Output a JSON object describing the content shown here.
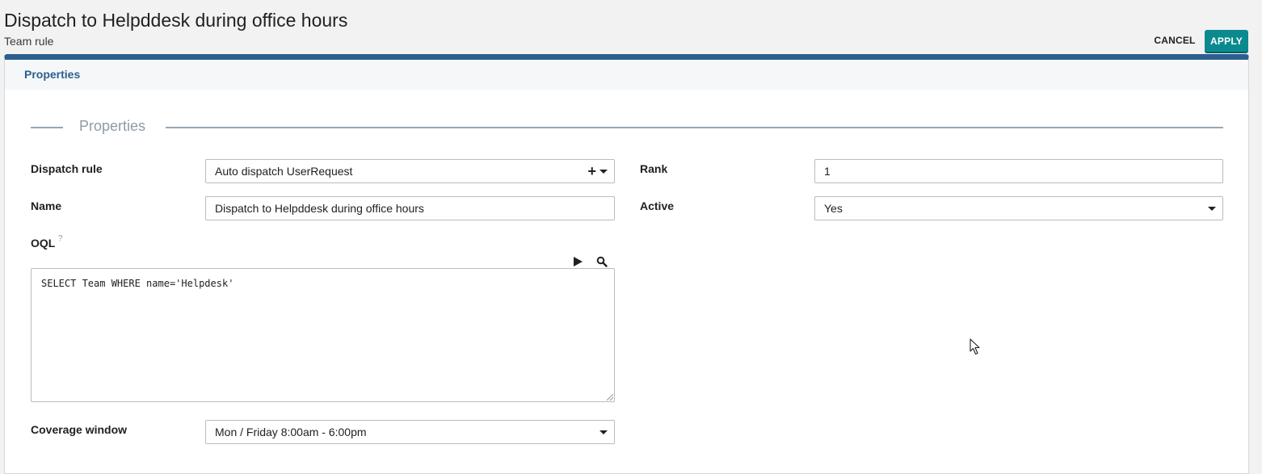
{
  "header": {
    "title": "Dispatch to Helpddesk during office hours",
    "subtitle": "Team rule",
    "cancel_label": "CANCEL",
    "apply_label": "APPLY"
  },
  "tabs": [
    {
      "label": "Properties",
      "active": true
    }
  ],
  "fieldset": {
    "legend": "Properties"
  },
  "fields": {
    "dispatch_rule": {
      "label": "Dispatch rule",
      "value": "Auto dispatch UserRequest"
    },
    "name": {
      "label": "Name",
      "value": "Dispatch to Helpddesk during office hours"
    },
    "oql": {
      "label": "OQL",
      "help": "?",
      "value": "SELECT Team WHERE name='Helpdesk'"
    },
    "coverage_window": {
      "label": "Coverage window",
      "value": "Mon / Friday 8:00am - 6:00pm"
    },
    "rank": {
      "label": "Rank",
      "value": "1"
    },
    "active": {
      "label": "Active",
      "value": "Yes"
    }
  },
  "icons": {
    "add": "plus-icon",
    "dropdown": "chevron-down-icon",
    "run": "play-icon",
    "search": "search-icon"
  },
  "colors": {
    "accent": "#2b5f8e",
    "apply_button": "#0a8a8f"
  }
}
